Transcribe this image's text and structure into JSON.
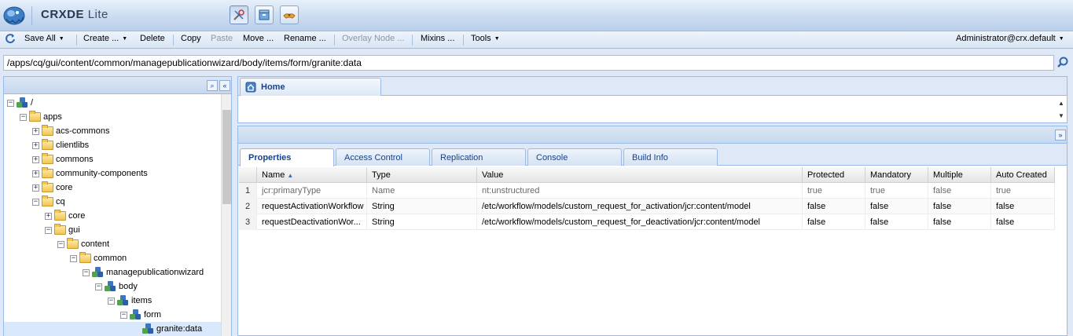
{
  "app": {
    "title_main": "CRXDE",
    "title_lite": "Lite"
  },
  "mode_buttons": [
    {
      "name": "develop-mode-icon"
    },
    {
      "name": "package-mode-icon"
    },
    {
      "name": "share-mode-icon"
    }
  ],
  "toolbar": {
    "save_all": "Save All",
    "create": "Create ...",
    "delete": "Delete",
    "copy": "Copy",
    "paste": "Paste",
    "move": "Move ...",
    "rename": "Rename ...",
    "overlay": "Overlay Node ...",
    "mixins": "Mixins ...",
    "tools": "Tools",
    "user": "Administrator@crx.default"
  },
  "path": {
    "value": "/apps/cq/gui/content/common/managepublicationwizard/body/items/form/granite:data"
  },
  "tree": {
    "nodes": [
      {
        "label": "/",
        "depth": 0,
        "state": "minus",
        "icon": "node",
        "selected": false
      },
      {
        "label": "apps",
        "depth": 1,
        "state": "minus",
        "icon": "folder",
        "selected": false
      },
      {
        "label": "acs-commons",
        "depth": 2,
        "state": "plus",
        "icon": "folder",
        "selected": false
      },
      {
        "label": "clientlibs",
        "depth": 2,
        "state": "plus",
        "icon": "folder",
        "selected": false
      },
      {
        "label": "commons",
        "depth": 2,
        "state": "plus",
        "icon": "folder",
        "selected": false
      },
      {
        "label": "community-components",
        "depth": 2,
        "state": "plus",
        "icon": "folder",
        "selected": false
      },
      {
        "label": "core",
        "depth": 2,
        "state": "plus",
        "icon": "folder",
        "selected": false
      },
      {
        "label": "cq",
        "depth": 2,
        "state": "minus",
        "icon": "folder",
        "selected": false
      },
      {
        "label": "core",
        "depth": 3,
        "state": "plus",
        "icon": "folder",
        "selected": false
      },
      {
        "label": "gui",
        "depth": 3,
        "state": "minus",
        "icon": "folder",
        "selected": false
      },
      {
        "label": "content",
        "depth": 4,
        "state": "minus",
        "icon": "folder",
        "selected": false
      },
      {
        "label": "common",
        "depth": 5,
        "state": "minus",
        "icon": "folder",
        "selected": false
      },
      {
        "label": "managepublicationwizard",
        "depth": 6,
        "state": "minus",
        "icon": "node",
        "selected": false
      },
      {
        "label": "body",
        "depth": 7,
        "state": "minus",
        "icon": "node",
        "selected": false
      },
      {
        "label": "items",
        "depth": 8,
        "state": "minus",
        "icon": "node",
        "selected": false
      },
      {
        "label": "form",
        "depth": 9,
        "state": "minus",
        "icon": "node",
        "selected": false
      },
      {
        "label": "granite:data",
        "depth": 10,
        "state": "none",
        "icon": "node",
        "selected": true
      }
    ]
  },
  "editor": {
    "home_tab": "Home"
  },
  "props": {
    "tabs": [
      "Properties",
      "Access Control",
      "Replication",
      "Console",
      "Build Info"
    ],
    "active_tab": 0,
    "columns": [
      "Name",
      "Type",
      "Value",
      "Protected",
      "Mandatory",
      "Multiple",
      "Auto Created"
    ],
    "rows": [
      {
        "num": "1",
        "name": "jcr:primaryType",
        "type": "Name",
        "value": "nt:unstructured",
        "protected": "true",
        "mandatory": "true",
        "multiple": "false",
        "auto_created": "true",
        "readonly": true
      },
      {
        "num": "2",
        "name": "requestActivationWorkflow",
        "type": "String",
        "value": "/etc/workflow/models/custom_request_for_activation/jcr:content/model",
        "protected": "false",
        "mandatory": "false",
        "multiple": "false",
        "auto_created": "false",
        "readonly": false
      },
      {
        "num": "3",
        "name": "requestDeactivationWor...",
        "type": "String",
        "value": "/etc/workflow/models/custom_request_for_deactivation/jcr:content/model",
        "protected": "false",
        "mandatory": "false",
        "multiple": "false",
        "auto_created": "false",
        "readonly": false
      }
    ]
  },
  "colors": {
    "accent": "#15428b",
    "border": "#99bbe8",
    "panel_bg": "#dfe8f6"
  }
}
